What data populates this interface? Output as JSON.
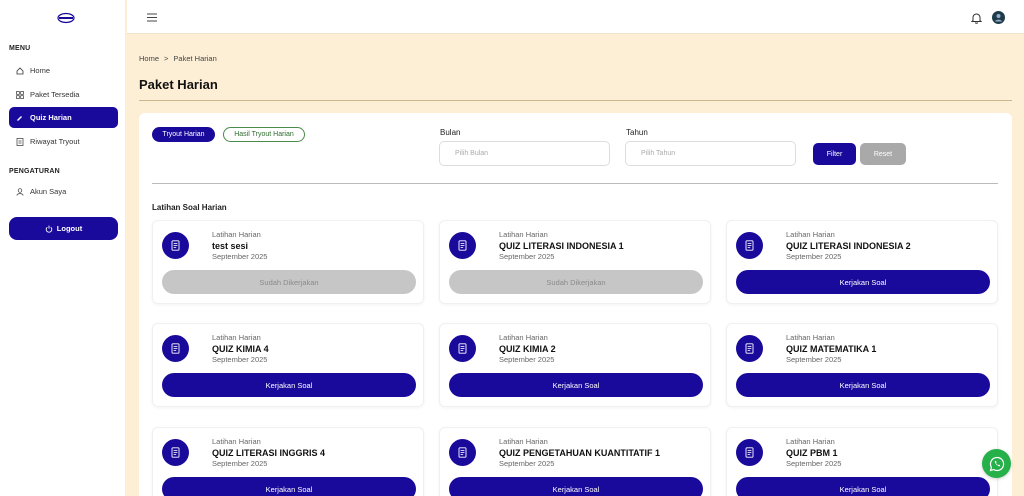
{
  "sidebar": {
    "menu_label": "MENU",
    "items": [
      {
        "label": "Home",
        "icon": "home-icon"
      },
      {
        "label": "Paket Tersedia",
        "icon": "grid-icon"
      },
      {
        "label": "Quiz Harian",
        "icon": "quiz-icon",
        "active": true
      },
      {
        "label": "Riwayat Tryout",
        "icon": "history-icon"
      }
    ],
    "settings_label": "PENGATURAN",
    "settings_items": [
      {
        "label": "Akun Saya",
        "icon": "user-icon"
      }
    ],
    "logout_label": "Logout"
  },
  "breadcrumb": {
    "home": "Home",
    "separator": ">",
    "current": "Paket Harian"
  },
  "page_title": "Paket Harian",
  "tabs": {
    "active": "Tryout Harian",
    "other": "Hasil Tryout Harian"
  },
  "filters": {
    "bulan_label": "Bulan",
    "bulan_placeholder": "Pilih Bulan",
    "tahun_label": "Tahun",
    "tahun_placeholder": "Pilih Tahun",
    "filter_button": "Filter",
    "reset_button": "Reset"
  },
  "section_title": "Latihan Soal Harian",
  "cards": [
    {
      "category": "Latihan Harian",
      "name": "test sesi",
      "date": "September 2025",
      "button": "Sudah Dikerjakan",
      "done": true
    },
    {
      "category": "Latihan Harian",
      "name": "QUIZ LITERASI INDONESIA 1",
      "date": "September 2025",
      "button": "Sudah Dikerjakan",
      "done": true
    },
    {
      "category": "Latihan Harian",
      "name": "QUIZ LITERASI INDONESIA 2",
      "date": "September 2025",
      "button": "Kerjakan Soal",
      "done": false
    },
    {
      "category": "Latihan Harian",
      "name": "QUIZ KIMIA 4",
      "date": "September 2025",
      "button": "Kerjakan Soal",
      "done": false
    },
    {
      "category": "Latihan Harian",
      "name": "QUIZ KIMIA 2",
      "date": "September 2025",
      "button": "Kerjakan Soal",
      "done": false
    },
    {
      "category": "Latihan Harian",
      "name": "QUIZ MATEMATIKA 1",
      "date": "September 2025",
      "button": "Kerjakan Soal",
      "done": false
    },
    {
      "category": "Latihan Harian",
      "name": "QUIZ LITERASI INGGRIS 4",
      "date": "September 2025",
      "button": "Kerjakan Soal",
      "done": false
    },
    {
      "category": "Latihan Harian",
      "name": "QUIZ PENGETAHUAN KUANTITATIF 1",
      "date": "September 2025",
      "button": "Kerjakan Soal",
      "done": false
    },
    {
      "category": "Latihan Harian",
      "name": "QUIZ PBM 1",
      "date": "September 2025",
      "button": "Kerjakan Soal",
      "done": false
    }
  ],
  "colors": {
    "primary": "#1a0a9c",
    "background": "#fdefd6",
    "disabled": "#c6c6c6",
    "whatsapp": "#25b04a"
  }
}
